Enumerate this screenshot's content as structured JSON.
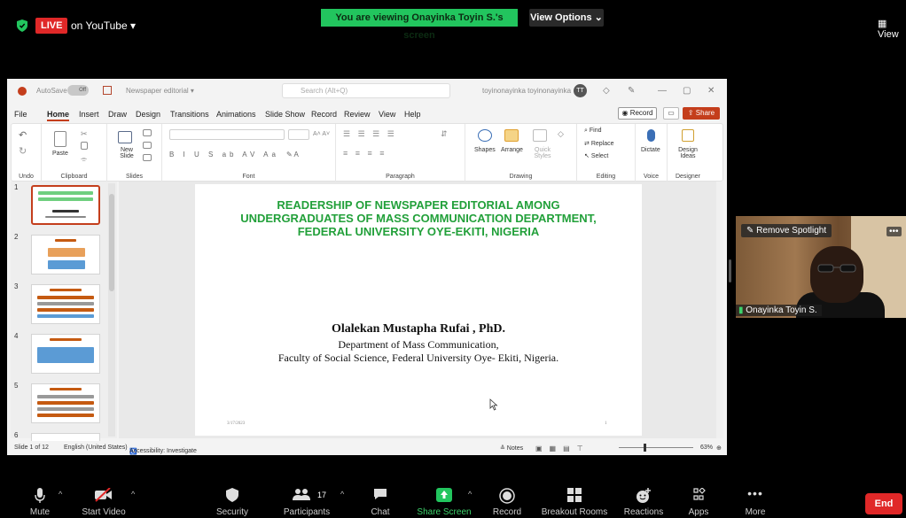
{
  "zoom_top": {
    "live": "LIVE",
    "on_youtube": "on YouTube ▾",
    "viewing_banner": "You are viewing Onayinka Toyin S.'s screen",
    "view_options": "View Options ⌄",
    "view_label": "View"
  },
  "ppt": {
    "autosave": "AutoSave",
    "autosave_state": "Off",
    "doc_name": "Newspaper editorial ▾",
    "search_placeholder": "Search (Alt+Q)",
    "user": "toyinonayinka toyinonayinka",
    "avatar": "TT",
    "menu": [
      "File",
      "Home",
      "Insert",
      "Draw",
      "Design",
      "Transitions",
      "Animations",
      "Slide Show",
      "Record",
      "Review",
      "View",
      "Help"
    ],
    "record_btn": "◉ Record",
    "share_btn": "⇪ Share",
    "ribbon": {
      "undo": "Undo",
      "clipboard": "Clipboard",
      "paste": "Paste",
      "slides": "Slides",
      "new_slide": "New Slide",
      "font": "Font",
      "paragraph": "Paragraph",
      "drawing": "Drawing",
      "shapes": "Shapes",
      "arrange": "Arrange",
      "quick_styles": "Quick Styles",
      "editing": "Editing",
      "find": "Find",
      "replace": "Replace",
      "select": "Select",
      "voice": "Voice",
      "dictate": "Dictate",
      "designer": "Designer",
      "design_ideas": "Design Ideas"
    },
    "thumbnails": [
      {
        "num": "1",
        "title": ""
      },
      {
        "num": "2",
        "title": ""
      },
      {
        "num": "3",
        "title": ""
      },
      {
        "num": "4",
        "title": ""
      },
      {
        "num": "5",
        "title": ""
      },
      {
        "num": "6",
        "title": ""
      }
    ],
    "slide": {
      "title": "READERSHIP OF NEWSPAPER EDITORIAL AMONG UNDERGRADUATES OF MASS COMMUNICATION DEPARTMENT, FEDERAL UNIVERSITY OYE-EKITI, NIGERIA",
      "author": "Olalekan Mustapha Rufai , PhD.",
      "department": "Department of Mass Communication,",
      "faculty": "Faculty of Social Science,  Federal University Oye- Ekiti, Nigeria.",
      "date": "3/17/2023",
      "number": "1"
    },
    "status": {
      "slide_of": "Slide 1 of 12",
      "language": "English (United States)",
      "accessibility": "Accessibility: Investigate",
      "notes": "≙ Notes",
      "zoom": "63%"
    }
  },
  "video": {
    "remove_spotlight": "Remove Spotlight",
    "participant_name": "Onayinka Toyin S."
  },
  "toolbar": {
    "mute": "Mute",
    "start_video": "Start Video",
    "security": "Security",
    "participants": "Participants",
    "participants_count": "17",
    "chat": "Chat",
    "share_screen": "Share Screen",
    "record": "Record",
    "breakout_rooms": "Breakout Rooms",
    "reactions": "Reactions",
    "apps": "Apps",
    "more": "More",
    "end": "End"
  },
  "colors": {
    "live_red": "#e02828",
    "banner_green": "#22c55e",
    "ppt_accent": "#c43e1c",
    "slide_title_green": "#22a03a"
  }
}
